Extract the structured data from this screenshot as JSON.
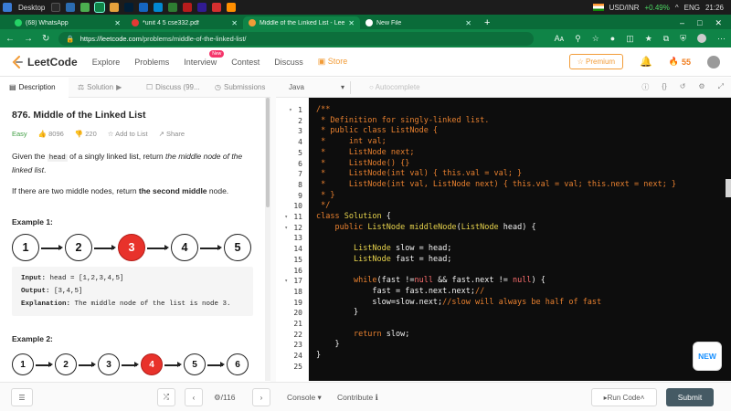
{
  "taskbar": {
    "desktop_label": "Desktop",
    "currency": "USD/INR",
    "currency_change": "+0.49%",
    "lang": "ENG",
    "time": "21:26"
  },
  "browser": {
    "tabs": [
      {
        "label": "(68) WhatsApp",
        "icon": "whatsapp-icon",
        "color": "#25d366"
      },
      {
        "label": "*unit 4 5 cse332.pdf",
        "icon": "pdf-icon",
        "color": "#e53935"
      },
      {
        "label": "Middle of the Linked List - LeetC",
        "icon": "leetcode-icon",
        "color": "#f29c38"
      },
      {
        "label": "New File",
        "icon": "github-icon",
        "color": "#ffffff"
      }
    ],
    "url_host": "https://leetcode.com",
    "url_path": "/problems/middle-of-the-linked-list/",
    "zoom_glyph": "Aᴀ"
  },
  "nav": {
    "logo_text": "LeetCode",
    "items": [
      "Explore",
      "Problems",
      "Interview",
      "Contest",
      "Discuss"
    ],
    "new_badge": "New",
    "store": "Store",
    "premium": "Premium",
    "streak": "55"
  },
  "left_tabs": [
    "Description",
    "Solution",
    "Discuss (99...",
    "Submissions"
  ],
  "problem": {
    "title": "876. Middle of the Linked List",
    "difficulty": "Easy",
    "likes": "8096",
    "dislikes": "220",
    "add_to_list": "Add to List",
    "share": "Share",
    "p1_a": "Given the ",
    "p1_code": "head",
    "p1_b": " of a singly linked list, return ",
    "p1_c": "the middle node of the linked list",
    "p1_d": ".",
    "p2_a": "If there are two middle nodes, return ",
    "p2_b": "the second middle",
    "p2_c": " node.",
    "example1": {
      "heading": "Example 1:",
      "nodes": [
        "1",
        "2",
        "3",
        "4",
        "5"
      ],
      "highlight_index": 2,
      "input_label": "Input:",
      "input": " head = [1,2,3,4,5]",
      "output_label": "Output:",
      "output": " [3,4,5]",
      "explanation_label": "Explanation:",
      "explanation": " The middle node of the list is node 3."
    },
    "example2": {
      "heading": "Example 2:",
      "nodes": [
        "1",
        "2",
        "3",
        "4",
        "5",
        "6"
      ],
      "highlight_index": 3
    }
  },
  "editor": {
    "language": "Java",
    "autocomplete": "Autocomplete",
    "fold_lines": [
      1,
      11,
      12,
      17
    ],
    "lines": [
      [
        [
          "c-com",
          "/**"
        ]
      ],
      [
        [
          "c-com",
          " * Definition for singly-linked list."
        ]
      ],
      [
        [
          "c-com",
          " * public class ListNode {"
        ]
      ],
      [
        [
          "c-com",
          " *     int val;"
        ]
      ],
      [
        [
          "c-com",
          " *     ListNode next;"
        ]
      ],
      [
        [
          "c-com",
          " *     ListNode() {}"
        ]
      ],
      [
        [
          "c-com",
          " *     ListNode(int val) { this.val = val; }"
        ]
      ],
      [
        [
          "c-com",
          " *     ListNode(int val, ListNode next) { this.val = val; this.next = next; }"
        ]
      ],
      [
        [
          "c-com",
          " * }"
        ]
      ],
      [
        [
          "c-com",
          " */"
        ]
      ],
      [
        [
          "c-kw",
          "class "
        ],
        [
          "c-type",
          "Solution"
        ],
        [
          "c-id",
          " {"
        ]
      ],
      [
        [
          "c-id",
          "    "
        ],
        [
          "c-kw",
          "public "
        ],
        [
          "c-type",
          "ListNode "
        ],
        [
          "c-fn",
          "middleNode"
        ],
        [
          "c-id",
          "("
        ],
        [
          "c-type",
          "ListNode "
        ],
        [
          "c-id",
          "head) {"
        ]
      ],
      [],
      [
        [
          "c-id",
          "        "
        ],
        [
          "c-type",
          "ListNode "
        ],
        [
          "c-id",
          "slow = head;"
        ]
      ],
      [
        [
          "c-id",
          "        "
        ],
        [
          "c-type",
          "ListNode "
        ],
        [
          "c-id",
          "fast = head;"
        ]
      ],
      [],
      [
        [
          "c-id",
          "        "
        ],
        [
          "c-kw",
          "while"
        ],
        [
          "c-id",
          "(fast !="
        ],
        [
          "c-num",
          "null"
        ],
        [
          "c-id",
          " && fast.next != "
        ],
        [
          "c-num",
          "null"
        ],
        [
          "c-id",
          ") {"
        ]
      ],
      [
        [
          "c-id",
          "            fast = fast.next.next;"
        ],
        [
          "c-com",
          "//"
        ]
      ],
      [
        [
          "c-id",
          "            slow=slow.next;"
        ],
        [
          "c-com",
          "//slow will always be half of fast"
        ]
      ],
      [
        [
          "c-id",
          "        }"
        ]
      ],
      [],
      [
        [
          "c-id",
          "        "
        ],
        [
          "c-kw",
          "return "
        ],
        [
          "c-id",
          "slow;"
        ]
      ],
      [
        [
          "c-id",
          "    }"
        ]
      ],
      [
        [
          "c-id",
          "}"
        ]
      ],
      []
    ],
    "new_button": "NEW"
  },
  "footer": {
    "page": "/116",
    "console": "Console",
    "contribute": "Contribute",
    "run_code": "Run Code",
    "submit": "Submit"
  }
}
